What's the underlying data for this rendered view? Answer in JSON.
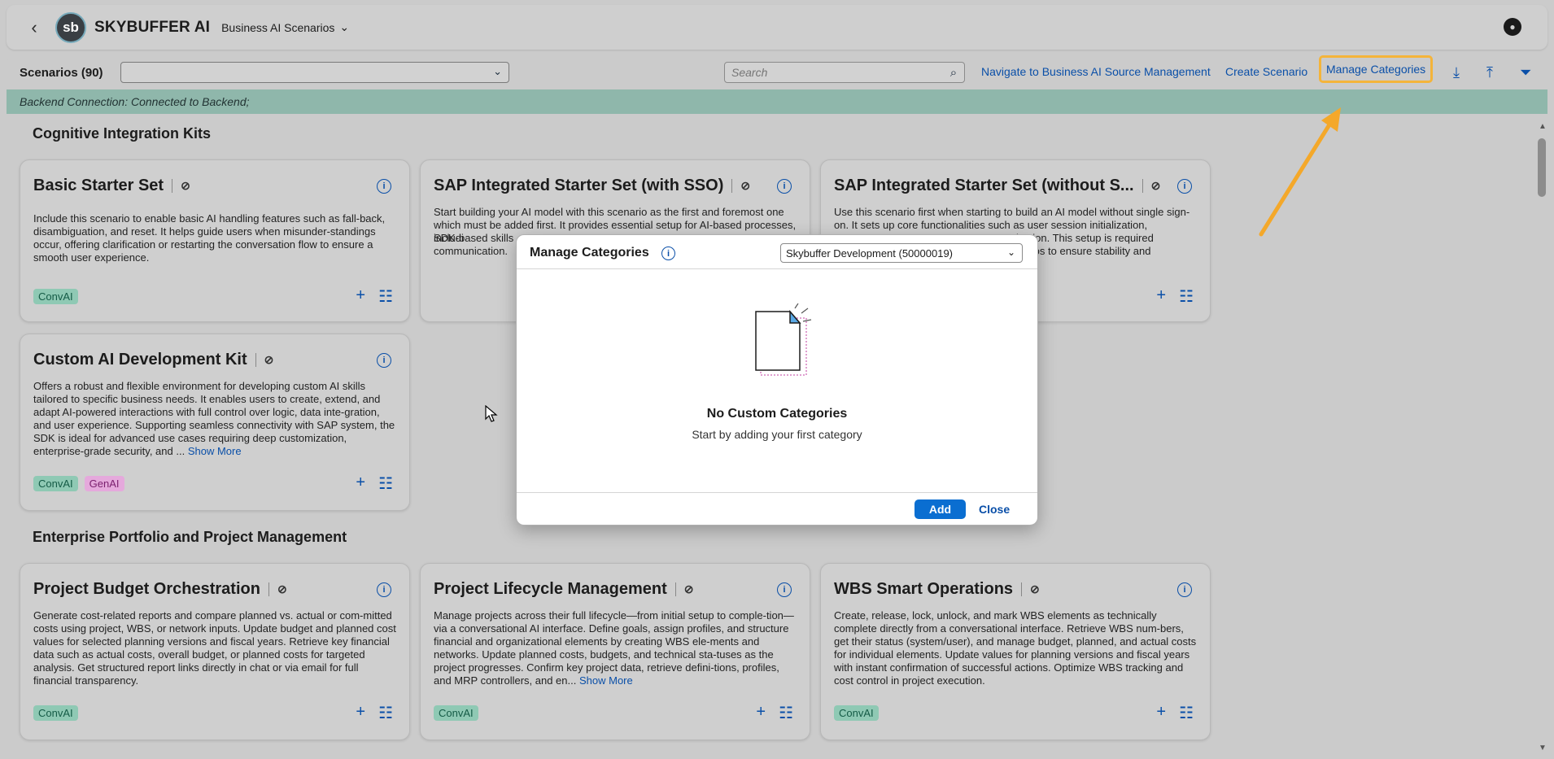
{
  "header": {
    "back_icon": "chevron-left-icon",
    "logo_text": "sb",
    "brand": "SKYBUFFER AI",
    "app_menu": "Business AI Scenarios",
    "github_icon": "github-icon"
  },
  "toolbar": {
    "title": "Scenarios (90)",
    "category_select_value": "",
    "search_placeholder": "Search",
    "nav_source": "Navigate to Business AI Source Management",
    "create": "Create Scenario",
    "manage": "Manage Categories"
  },
  "banner": "Backend Connection: Connected to Backend;",
  "sections": [
    {
      "title": "Cognitive Integration Kits",
      "cards": [
        {
          "title": "Basic Starter Set",
          "desc": "Include this scenario to enable basic AI handling features such as fall-back, disambiguation, and reset. It helps guide users when misunder-standings occur, offering clarification or restarting the conversation flow to ensure a smooth user experience.",
          "tags": [
            "ConvAI"
          ]
        },
        {
          "title": "SAP Integrated Starter Set (with SSO)",
          "desc": "Start building your AI model with this scenario as the first and foremost one which must be added first. It provides essential setup for AI-based processes, includi",
          "desc2": "SDK-based skills",
          "desc3": "communication.",
          "tags": []
        },
        {
          "title": "SAP Integrated Starter Set (without S...",
          "desc": "Use this scenario first when starting to build an AI model without single sign-on. It sets up core functionalities such as user session initialization,",
          "desc2": "ication. This setup is required",
          "desc3": "narios to ensure stability and",
          "tags": []
        },
        {
          "title": "Custom AI Development Kit",
          "desc": "Offers a robust and flexible environment for developing custom AI skills tailored to specific business needs. It enables users to create, extend, and adapt AI-powered interactions with full control over logic, data inte-gration, and user experience. Supporting seamless connectivity with SAP system, the SDK is ideal for advanced use cases requiring deep customization, enterprise-grade security, and ...",
          "show_more": "Show More",
          "tags": [
            "ConvAI",
            "GenAI"
          ]
        }
      ]
    },
    {
      "title": "Enterprise Portfolio and Project Management",
      "cards": [
        {
          "title": "Project Budget Orchestration",
          "desc": "Generate cost-related reports and compare planned vs. actual or com-mitted costs using project, WBS, or network inputs. Update budget and planned cost values for selected planning versions and fiscal years. Retrieve key financial data such as actual costs, overall budget, or planned costs for targeted analysis. Get structured report links directly in chat or via email for full financial transparency.",
          "tags": [
            "ConvAI"
          ]
        },
        {
          "title": "Project Lifecycle Management",
          "desc": "Manage projects across their full lifecycle—from initial setup to comple-tion—via a conversational AI interface. Define goals, assign profiles, and structure financial and organizational elements by creating WBS ele-ments and networks. Update planned costs, budgets, and technical sta-tuses as the project progresses. Confirm key project data, retrieve defini-tions, profiles, and MRP controllers, and en...",
          "show_more": "Show More",
          "tags": [
            "ConvAI"
          ]
        },
        {
          "title": "WBS Smart Operations",
          "desc": "Create, release, lock, unlock, and mark WBS elements as technically complete directly from a conversational interface. Retrieve WBS num-bers, get their status (system/user), and manage budget, planned, and actual costs for individual elements. Update values for planning versions and fiscal years with instant confirmation of successful actions. Optimize WBS tracking and cost control in project execution.",
          "tags": [
            "ConvAI"
          ]
        }
      ]
    }
  ],
  "dialog": {
    "title": "Manage Categories",
    "select_value": "Skybuffer Development (50000019)",
    "empty_title": "No Custom Categories",
    "empty_sub": "Start by adding your first category",
    "add": "Add",
    "close": "Close"
  },
  "colors": {
    "accent": "#0a6ed1",
    "link": "#0a4fa8",
    "highlight": "#f4b43a",
    "banner": "#8fb7ab",
    "tag_convai": "#8fc9b4",
    "tag_genai": "#e5a9dc"
  }
}
